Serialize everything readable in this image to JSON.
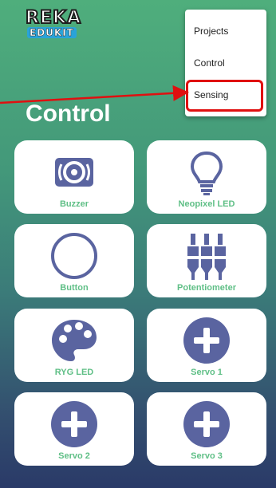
{
  "logo": {
    "line1": "REKA",
    "line2": "EDUKIT"
  },
  "page_title": "Control",
  "menu": {
    "items": [
      "Projects",
      "Control",
      "Sensing"
    ],
    "highlighted": "Sensing"
  },
  "cards": [
    {
      "label": "Buzzer",
      "icon": "speaker-icon"
    },
    {
      "label": "Neopixel LED",
      "icon": "lightbulb-icon"
    },
    {
      "label": "Button",
      "icon": "circle-button-icon"
    },
    {
      "label": "Potentiometer",
      "icon": "sliders-icon"
    },
    {
      "label": "RYG LED",
      "icon": "palette-icon"
    },
    {
      "label": "Servo 1",
      "icon": "plus-circle-icon"
    },
    {
      "label": "Servo 2",
      "icon": "plus-circle-icon"
    },
    {
      "label": "Servo 3",
      "icon": "plus-circle-icon"
    }
  ],
  "colors": {
    "icon": "#5a64a0",
    "label": "#5fbf86",
    "highlight": "#e01010"
  }
}
